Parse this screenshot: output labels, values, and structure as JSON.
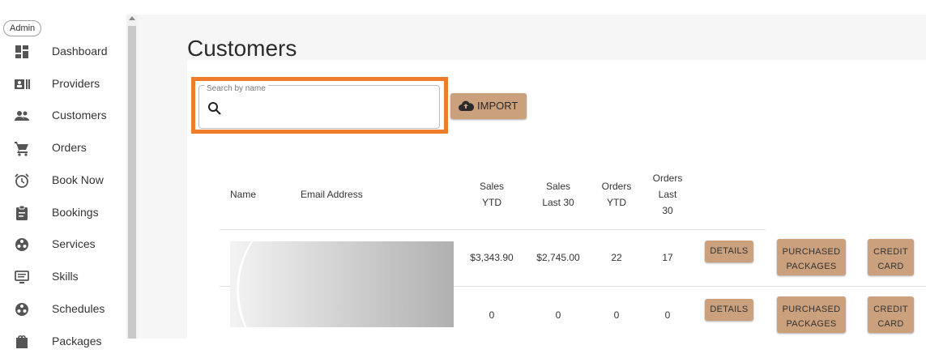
{
  "sidebar": {
    "badge": "Admin",
    "items": [
      {
        "label": "Dashboard",
        "icon": "dashboard-icon"
      },
      {
        "label": "Providers",
        "icon": "id-card-icon"
      },
      {
        "label": "Customers",
        "icon": "people-icon"
      },
      {
        "label": "Orders",
        "icon": "cart-icon"
      },
      {
        "label": "Book Now",
        "icon": "alarm-clock-icon"
      },
      {
        "label": "Bookings",
        "icon": "clipboard-icon"
      },
      {
        "label": "Services",
        "icon": "network-icon"
      },
      {
        "label": "Skills",
        "icon": "monitor-icon"
      },
      {
        "label": "Schedules",
        "icon": "network-icon"
      },
      {
        "label": "Packages",
        "icon": "package-icon"
      }
    ]
  },
  "main": {
    "title": "Customers",
    "search": {
      "legend": "Search by name",
      "value": "",
      "placeholder": ""
    },
    "import_label": "IMPORT"
  },
  "table": {
    "headers": {
      "name": "Name",
      "email": "Email Address",
      "sales_ytd": [
        "Sales",
        "YTD"
      ],
      "sales_last30": [
        "Sales",
        "Last 30"
      ],
      "orders_ytd": [
        "Orders",
        "YTD"
      ],
      "orders_last30": [
        "Orders",
        "Last",
        "30"
      ]
    },
    "rows": [
      {
        "sales_ytd": "$3,343.90",
        "sales_last30": "$2,745.00",
        "orders_ytd": "22",
        "orders_last30": "17"
      },
      {
        "sales_ytd": "0",
        "sales_last30": "0",
        "orders_ytd": "0",
        "orders_last30": "0"
      }
    ],
    "actions": {
      "details": "DETAILS",
      "packages": [
        "PURCHASED",
        "PACKAGES"
      ],
      "credit": [
        "CREDIT",
        "CARD"
      ]
    }
  },
  "colors": {
    "accent_button": "#caa07d",
    "highlight_border": "#ee7d2b"
  }
}
